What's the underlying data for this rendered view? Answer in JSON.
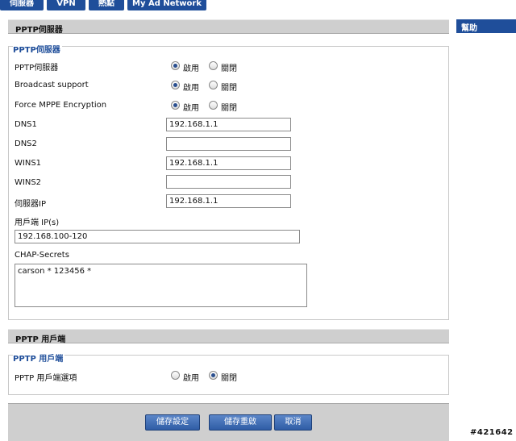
{
  "tabs": [
    {
      "label": "伺服器"
    },
    {
      "label": "VPN"
    },
    {
      "label": "熱點"
    },
    {
      "label": "My Ad Network"
    }
  ],
  "pptp_server": {
    "section_title": "PPTP伺服器",
    "legend": "PPTP伺服器",
    "rows": [
      {
        "label": "PPTP伺服器",
        "on_label": "啟用",
        "off_label": "關閉",
        "selected": "on"
      },
      {
        "label": "Broadcast support",
        "on_label": "啟用",
        "off_label": "關閉",
        "selected": "on"
      },
      {
        "label": "Force MPPE Encryption",
        "on_label": "啟用",
        "off_label": "關閉",
        "selected": "on"
      }
    ],
    "dns1": {
      "label": "DNS1",
      "value": "192.168.1.1"
    },
    "dns2": {
      "label": "DNS2",
      "value": ""
    },
    "wins1": {
      "label": "WINS1",
      "value": "192.168.1.1"
    },
    "wins2": {
      "label": "WINS2",
      "value": ""
    },
    "server_ip": {
      "label": "伺服器IP",
      "value": "192.168.1.1"
    },
    "client_ips": {
      "label": "用戶端 IP(s)",
      "value": "192.168.100-120"
    },
    "chap_secrets": {
      "label": "CHAP-Secrets",
      "value": "carson * 123456 *"
    }
  },
  "pptp_client": {
    "section_title": "PPTP 用戶端",
    "legend": "PPTP 用戶端",
    "option": {
      "label": "PPTP 用戶端選項",
      "on_label": "啟用",
      "off_label": "關閉",
      "selected": "off"
    }
  },
  "help": {
    "title": "幫助"
  },
  "buttons": {
    "save": "儲存設定",
    "apply": "儲存重啟",
    "cancel": "取消"
  },
  "watermark": "#421642"
}
